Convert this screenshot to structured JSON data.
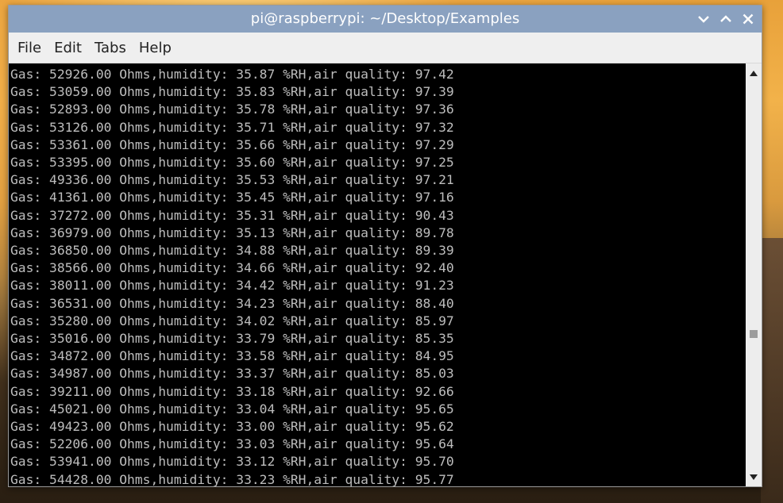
{
  "window": {
    "title": "pi@raspberrypi: ~/Desktop/Examples"
  },
  "menu": [
    "File",
    "Edit",
    "Tabs",
    "Help"
  ],
  "icons": {
    "minimize": "chevron-down-icon",
    "maximize": "chevron-up-icon",
    "close": "close-icon"
  },
  "colors": {
    "titlebar": "#8aa1c0",
    "terminal_bg": "#000000",
    "terminal_fg": "#bdbdbd"
  },
  "terminal": {
    "lines": [
      "Gas: 52926.00 Ohms,humidity: 35.87 %RH,air quality: 97.42",
      "Gas: 53059.00 Ohms,humidity: 35.83 %RH,air quality: 97.39",
      "Gas: 52893.00 Ohms,humidity: 35.78 %RH,air quality: 97.36",
      "Gas: 53126.00 Ohms,humidity: 35.71 %RH,air quality: 97.32",
      "Gas: 53361.00 Ohms,humidity: 35.66 %RH,air quality: 97.29",
      "Gas: 53395.00 Ohms,humidity: 35.60 %RH,air quality: 97.25",
      "Gas: 49336.00 Ohms,humidity: 35.53 %RH,air quality: 97.21",
      "Gas: 41361.00 Ohms,humidity: 35.45 %RH,air quality: 97.16",
      "Gas: 37272.00 Ohms,humidity: 35.31 %RH,air quality: 90.43",
      "Gas: 36979.00 Ohms,humidity: 35.13 %RH,air quality: 89.78",
      "Gas: 36850.00 Ohms,humidity: 34.88 %RH,air quality: 89.39",
      "Gas: 38566.00 Ohms,humidity: 34.66 %RH,air quality: 92.40",
      "Gas: 38011.00 Ohms,humidity: 34.42 %RH,air quality: 91.23",
      "Gas: 36531.00 Ohms,humidity: 34.23 %RH,air quality: 88.40",
      "Gas: 35280.00 Ohms,humidity: 34.02 %RH,air quality: 85.97",
      "Gas: 35016.00 Ohms,humidity: 33.79 %RH,air quality: 85.35",
      "Gas: 34872.00 Ohms,humidity: 33.58 %RH,air quality: 84.95",
      "Gas: 34987.00 Ohms,humidity: 33.37 %RH,air quality: 85.03",
      "Gas: 39211.00 Ohms,humidity: 33.18 %RH,air quality: 92.66",
      "Gas: 45021.00 Ohms,humidity: 33.04 %RH,air quality: 95.65",
      "Gas: 49423.00 Ohms,humidity: 33.00 %RH,air quality: 95.62",
      "Gas: 52206.00 Ohms,humidity: 33.03 %RH,air quality: 95.64",
      "Gas: 53941.00 Ohms,humidity: 33.12 %RH,air quality: 95.70",
      "Gas: 54428.00 Ohms,humidity: 33.23 %RH,air quality: 95.77"
    ]
  },
  "scrollbar": {
    "up": "scroll-up-arrow-icon",
    "down": "scroll-down-arrow-icon"
  }
}
